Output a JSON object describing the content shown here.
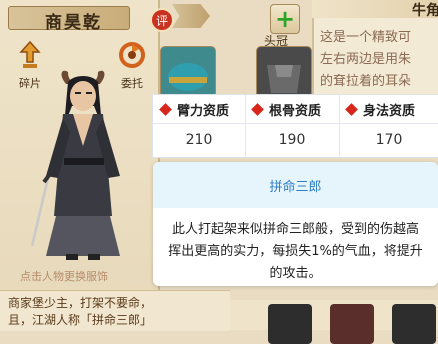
{
  "character": {
    "name": "商昊乾",
    "review_badge": "评",
    "hint": "点击人物更换服饰"
  },
  "buttons": {
    "fragments_label": "碎片",
    "entrust_label": "委托",
    "headgear_label": "头冠"
  },
  "bio": {
    "line1": "商家堡少主，打架不要命，",
    "line2": "且，江湖人称「拼命三郎」"
  },
  "description": {
    "title": "牛角",
    "line1": "这是一个精致可",
    "line2": "左右两边是用朱",
    "line3": "的耷拉着的耳朵"
  },
  "attributes": {
    "headers": [
      "臂力资质",
      "根骨资质",
      "身法资质"
    ],
    "values": [
      "210",
      "190",
      "170"
    ]
  },
  "skill": {
    "title": "拼命三郎",
    "line1": "此人打起架来似拼命三郎般，受到的伤越高",
    "line2": "挥出更高的实力，每损失1%的气血，将提升",
    "line3": "的攻击。"
  },
  "colors": {
    "accent_red": "#d7261c",
    "skill_blue": "#2f7fc7",
    "panel_bg": "#e9dcc2"
  }
}
